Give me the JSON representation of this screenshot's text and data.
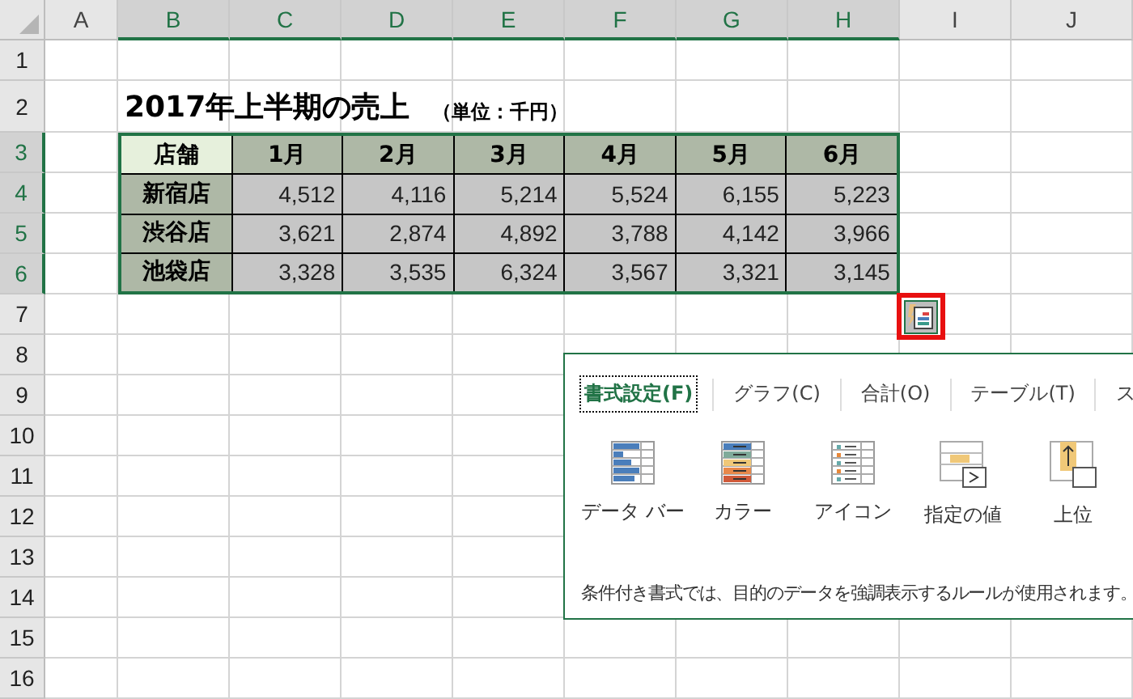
{
  "columns": [
    {
      "label": "A",
      "selected": false
    },
    {
      "label": "B",
      "selected": true
    },
    {
      "label": "C",
      "selected": true
    },
    {
      "label": "D",
      "selected": true
    },
    {
      "label": "E",
      "selected": true
    },
    {
      "label": "F",
      "selected": true
    },
    {
      "label": "G",
      "selected": true
    },
    {
      "label": "H",
      "selected": true
    },
    {
      "label": "I",
      "selected": false
    },
    {
      "label": "J",
      "selected": false
    }
  ],
  "rows": [
    {
      "label": "1",
      "selected": false
    },
    {
      "label": "2",
      "selected": false
    },
    {
      "label": "3",
      "selected": true
    },
    {
      "label": "4",
      "selected": true
    },
    {
      "label": "5",
      "selected": true
    },
    {
      "label": "6",
      "selected": true
    },
    {
      "label": "7",
      "selected": false
    },
    {
      "label": "8",
      "selected": false
    },
    {
      "label": "9",
      "selected": false
    },
    {
      "label": "10",
      "selected": false
    },
    {
      "label": "11",
      "selected": false
    },
    {
      "label": "12",
      "selected": false
    },
    {
      "label": "13",
      "selected": false
    },
    {
      "label": "14",
      "selected": false
    },
    {
      "label": "15",
      "selected": false
    },
    {
      "label": "16",
      "selected": false
    }
  ],
  "title": "2017年上半期の売上",
  "unit": "（単位：千円）",
  "table": {
    "header": [
      "店舗",
      "1月",
      "2月",
      "3月",
      "4月",
      "5月",
      "6月"
    ],
    "rows": [
      {
        "store": "新宿店",
        "values": [
          "4,512",
          "4,116",
          "5,214",
          "5,524",
          "6,155",
          "5,223"
        ]
      },
      {
        "store": "渋谷店",
        "values": [
          "3,621",
          "2,874",
          "4,892",
          "3,788",
          "4,142",
          "3,966"
        ]
      },
      {
        "store": "池袋店",
        "values": [
          "3,328",
          "3,535",
          "6,324",
          "3,567",
          "3,321",
          "3,145"
        ]
      }
    ]
  },
  "quick_analysis": {
    "tabs": [
      {
        "label": "書式設定(F)",
        "selected": true
      },
      {
        "label": "グラフ(C)",
        "selected": false
      },
      {
        "label": "合計(O)",
        "selected": false
      },
      {
        "label": "テーブル(T)",
        "selected": false
      },
      {
        "label": "ス",
        "selected": false
      }
    ],
    "options": [
      {
        "kind": "databar",
        "label": "データ バー"
      },
      {
        "kind": "colorscale",
        "label": "カラー"
      },
      {
        "kind": "iconset",
        "label": "アイコン"
      },
      {
        "kind": "greater",
        "label": "指定の値"
      },
      {
        "kind": "top",
        "label": "上位"
      }
    ],
    "description": "条件付き書式では、目的のデータを強調表示するルールが使用されます。"
  }
}
